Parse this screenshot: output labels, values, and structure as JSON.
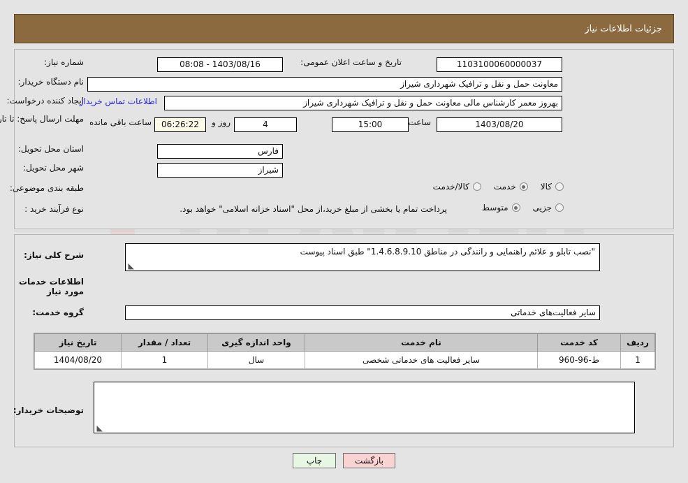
{
  "header": {
    "title": "جزئیات اطلاعات نیاز"
  },
  "fields": {
    "need_number_label": "شماره نیاز:",
    "need_number_value": "1103100060000037",
    "announce_datetime_label": "تاریخ و ساعت اعلان عمومی:",
    "announce_datetime_value": "1403/08/16 - 08:08",
    "buyer_org_label": "نام دستگاه خریدار:",
    "buyer_org_value": "معاونت حمل و نقل و ترافیک شهرداری شیراز",
    "requester_label": "ایجاد کننده درخواست:",
    "requester_value": "بهروز معمر کارشناس مالی معاونت حمل و نقل و ترافیک شهرداری شیراز",
    "buyer_contact_link": "اطلاعات تماس خریدار",
    "deadline_label": "مهلت ارسال پاسخ: تا تاریخ:",
    "deadline_date": "1403/08/20",
    "hour_label": "ساعت",
    "deadline_time": "15:00",
    "days_remaining": "4",
    "days_word": "روز و",
    "remaining_timer": "06:26:22",
    "remaining_label": "ساعت باقی مانده",
    "province_label": "استان محل تحویل:",
    "province_value": "فارس",
    "city_label": "شهر محل تحویل:",
    "city_value": "شیراز",
    "category_label": "طبقه بندی موضوعی:",
    "process_label": "نوع فرآیند خرید :",
    "treasury_note": "پرداخت تمام یا بخشی از مبلغ خرید،از محل \"اسناد خزانه اسلامی\" خواهد بود."
  },
  "category_options": [
    {
      "label": "کالا",
      "checked": false
    },
    {
      "label": "خدمت",
      "checked": true
    },
    {
      "label": "کالا/خدمت",
      "checked": false
    }
  ],
  "process_options": [
    {
      "label": "جزیی",
      "checked": false
    },
    {
      "label": "متوسط",
      "checked": true
    }
  ],
  "description": {
    "label": "شرح کلی نیاز:",
    "value": "\"نصب تابلو و علائم راهنمایی و رانندگی در مناطق 1.4.6.8.9.10\"  طبق اسناد پیوست",
    "resize_grip": "◣"
  },
  "services_section": {
    "heading": "اطلاعات خدمات مورد نیاز",
    "group_label": "گروه خدمت:",
    "group_value": "سایر فعالیت‌های خدماتی"
  },
  "table": {
    "columns": [
      "ردیف",
      "کد خدمت",
      "نام خدمت",
      "واحد اندازه گیری",
      "تعداد / مقدار",
      "تاریخ نیاز"
    ],
    "rows": [
      {
        "row_no": "1",
        "service_code": "ط-96-960",
        "service_name": "سایر فعالیت های خدماتی شخصی",
        "unit": "سال",
        "quantity": "1",
        "need_date": "1404/08/20"
      }
    ]
  },
  "buyer_notes": {
    "label": "توضیحات خریدار:",
    "value": "",
    "resize_grip": "◣"
  },
  "buttons": {
    "back": "بازگشت",
    "print": "چاپ"
  },
  "watermark": {
    "text": "AriaTender.net"
  },
  "colors": {
    "header_bar": "#8b6a40",
    "page_bg": "#e4e4e4",
    "link": "#2626d8",
    "back_button": "#f9d2d2",
    "print_button": "#e7f7e4",
    "table_header": "#c9c9c9"
  }
}
